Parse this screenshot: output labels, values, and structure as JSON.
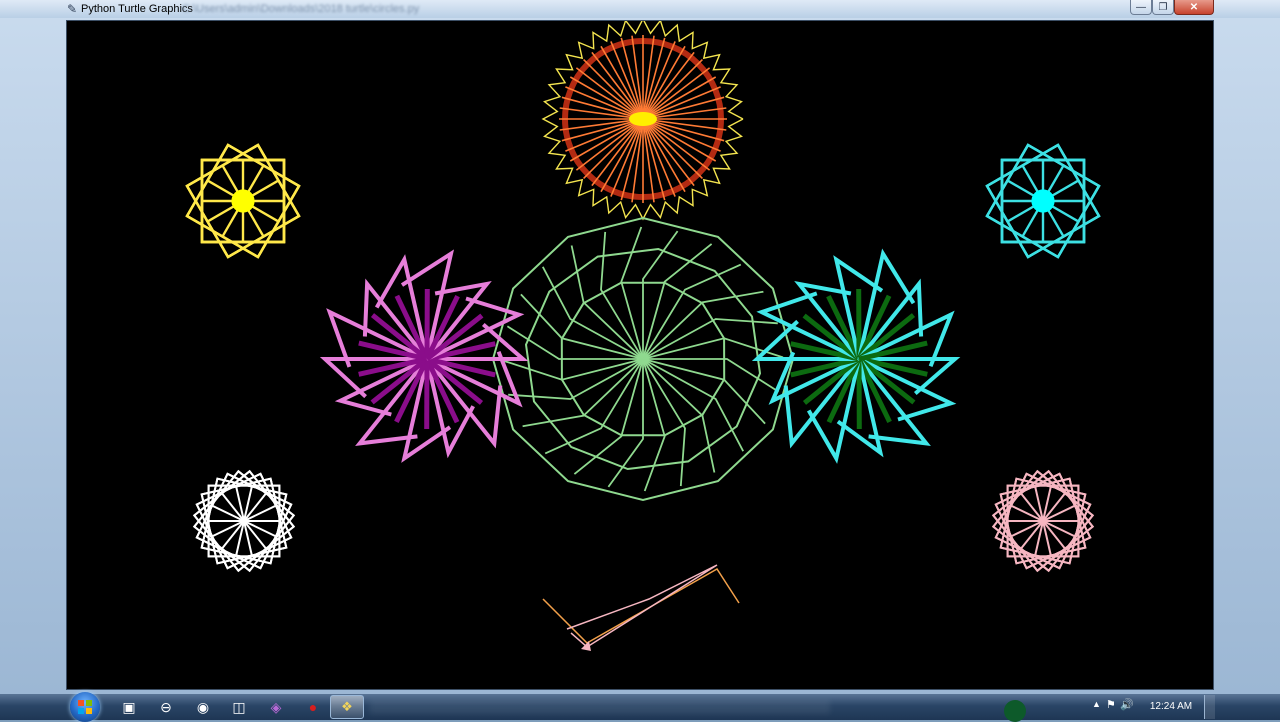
{
  "window": {
    "title": "Python Turtle Graphics",
    "title_path_blurred": "C:\\Users\\admin\\Downloads\\2018 turtle\\circles.py",
    "controls": {
      "minimize": "—",
      "maximize": "❐",
      "close": "✕"
    }
  },
  "canvas": {
    "background": "#000000",
    "figures": [
      {
        "name": "yellow-star-polygon",
        "color": "#ffe84a",
        "center_color": "#ffff00"
      },
      {
        "name": "orange-red-sun",
        "color": "#ff7b35",
        "outer_color": "#f3e44f",
        "inner_color": "#b32a12"
      },
      {
        "name": "cyan-star-polygon",
        "color": "#3de0e3",
        "center_color": "#00ffff"
      },
      {
        "name": "magenta-spiral-flower",
        "color": "#e67ed9",
        "secondary_color": "#8a0d8a"
      },
      {
        "name": "light-green-rosette",
        "color": "#8fd98f"
      },
      {
        "name": "cyan-green-spiral-flower",
        "color": "#41e8ea",
        "secondary_color": "#0c6a10"
      },
      {
        "name": "white-star-polygon",
        "color": "#ffffff"
      },
      {
        "name": "pink-star-polygon",
        "color": "#f6b6c1"
      },
      {
        "name": "orange-pink-turtle-trail",
        "color": "#f2a04a",
        "secondary_color": "#f6b6c1"
      }
    ]
  },
  "taskbar": {
    "start_icon": "windows-orb-icon",
    "pinned": [
      {
        "name": "explorer-icon",
        "glyph": "▣"
      },
      {
        "name": "media-icon",
        "glyph": "⊖"
      },
      {
        "name": "chrome-icon",
        "glyph": "◉"
      },
      {
        "name": "app-icon",
        "glyph": "◫"
      },
      {
        "name": "visual-studio-icon",
        "glyph": "◈"
      },
      {
        "name": "record-icon",
        "glyph": "●"
      }
    ],
    "active_app_icon": "python-icon",
    "tray": {
      "arrow": "▲",
      "flag": "⚑",
      "volume": "🔊"
    },
    "clock": "12:24 AM"
  }
}
